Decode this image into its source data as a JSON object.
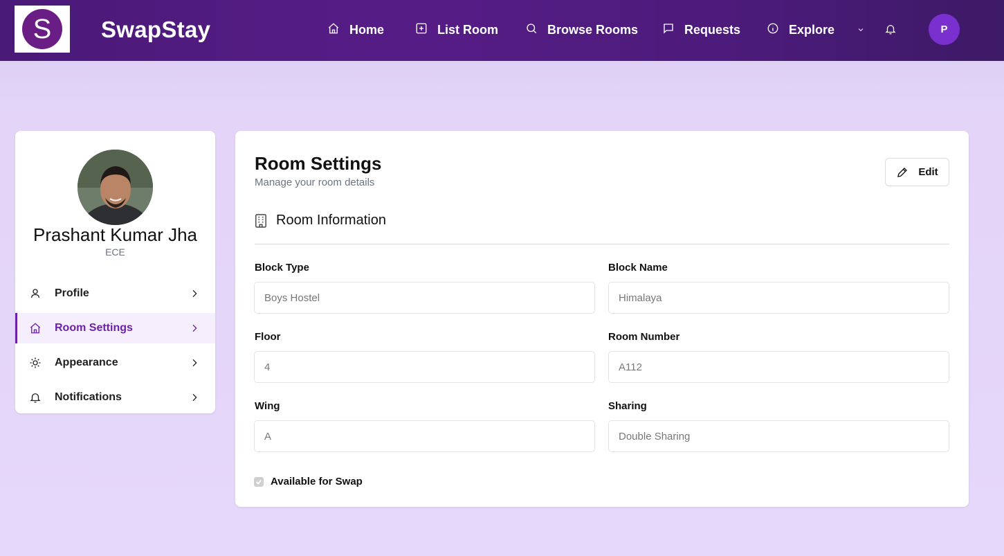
{
  "brand": {
    "logo_letter": "S",
    "name": "SwapStay"
  },
  "nav": {
    "items": [
      {
        "label": "Home",
        "icon": "home-icon"
      },
      {
        "label": "List Room",
        "icon": "plus-square-icon"
      },
      {
        "label": "Browse Rooms",
        "icon": "search-icon"
      },
      {
        "label": "Requests",
        "icon": "message-icon"
      },
      {
        "label": "Explore",
        "icon": "info-icon"
      }
    ],
    "avatar_initial": "P"
  },
  "profile": {
    "name": "Prashant Kumar Jha",
    "department": "ECE"
  },
  "sidebar": {
    "items": [
      {
        "label": "Profile",
        "icon": "user-icon",
        "active": false
      },
      {
        "label": "Room Settings",
        "icon": "home-icon",
        "active": true
      },
      {
        "label": "Appearance",
        "icon": "sun-icon",
        "active": false
      },
      {
        "label": "Notifications",
        "icon": "bell-icon",
        "active": false
      }
    ]
  },
  "main": {
    "title": "Room Settings",
    "subtitle": "Manage your room details",
    "edit_label": "Edit",
    "section_title": "Room Information",
    "fields": {
      "block_type": {
        "label": "Block Type",
        "value": "Boys Hostel"
      },
      "block_name": {
        "label": "Block Name",
        "value": "Himalaya"
      },
      "floor": {
        "label": "Floor",
        "value": "4"
      },
      "room_number": {
        "label": "Room Number",
        "value": "A112"
      },
      "wing": {
        "label": "Wing",
        "value": "A"
      },
      "sharing": {
        "label": "Sharing",
        "value": "Double Sharing"
      }
    },
    "available_label": "Available for Swap",
    "available_checked": true
  },
  "colors": {
    "accent": "#6b21a8",
    "nav_bg": "#561c86",
    "page_bg": "#e3d4f8"
  }
}
